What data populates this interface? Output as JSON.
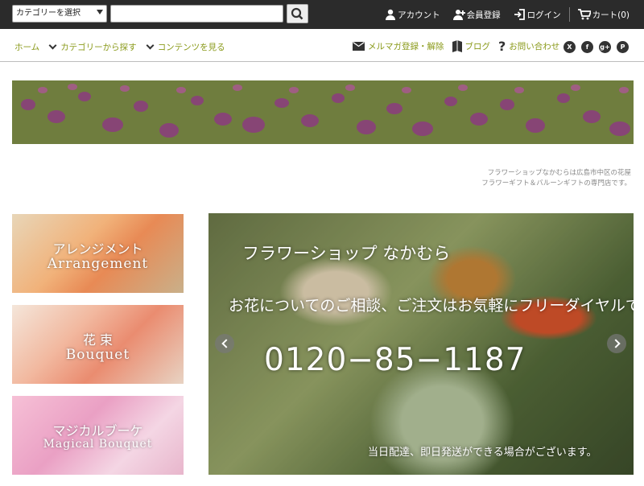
{
  "header": {
    "category_select": "カテゴリーを選択",
    "search_placeholder": "",
    "links": {
      "account": "アカウント",
      "register": "会員登録",
      "login": "ログイン",
      "cart": "カート(0)"
    }
  },
  "nav": {
    "home": "ホーム",
    "category": "カテゴリーから探す",
    "contents": "コンテンツを見る",
    "mailmag": "メルマガ登録・解除",
    "blog": "ブログ",
    "contact": "お問い合わせ"
  },
  "tagline": {
    "line1": "フラワーショップなかむらは広島市中区の花屋",
    "line2": "フラワーギフト＆バルーンギフトの専門店です。"
  },
  "tiles": [
    {
      "jp": "アレンジメント",
      "en": "Arrangement"
    },
    {
      "jp": "花 束",
      "en": "Bouquet"
    },
    {
      "jp": "マジカルブーケ",
      "en": "Magical Bouquet"
    }
  ],
  "hero": {
    "title": "フラワーショップ なかむら",
    "subtitle": "お花についてのご相談、ご注文はお気軽にフリーダイヤルで！",
    "phone": "0120−85−1187",
    "note": "当日配達、即日発送ができる場合がございます。"
  }
}
